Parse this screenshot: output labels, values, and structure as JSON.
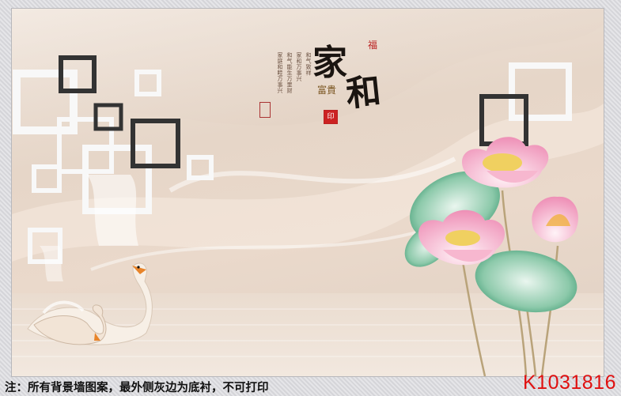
{
  "calligraphy": {
    "main_chars": [
      "家",
      "和"
    ],
    "seal_top": "福",
    "seal_side": "富貴",
    "seal_red": "印",
    "poem_lines": [
      "和气致祥",
      "家和万事兴",
      "和气能生万里财",
      "家庭和睦万事兴"
    ]
  },
  "footer": {
    "note": "注：所有背景墙图案，最外侧灰边为底衬，不可打印",
    "code": "K1031816"
  },
  "colors": {
    "frame_gray": "#dcdce0",
    "code_red": "#e01010",
    "lotus_pink": "#f2a7c4",
    "leaf_green": "#5fb08a"
  }
}
